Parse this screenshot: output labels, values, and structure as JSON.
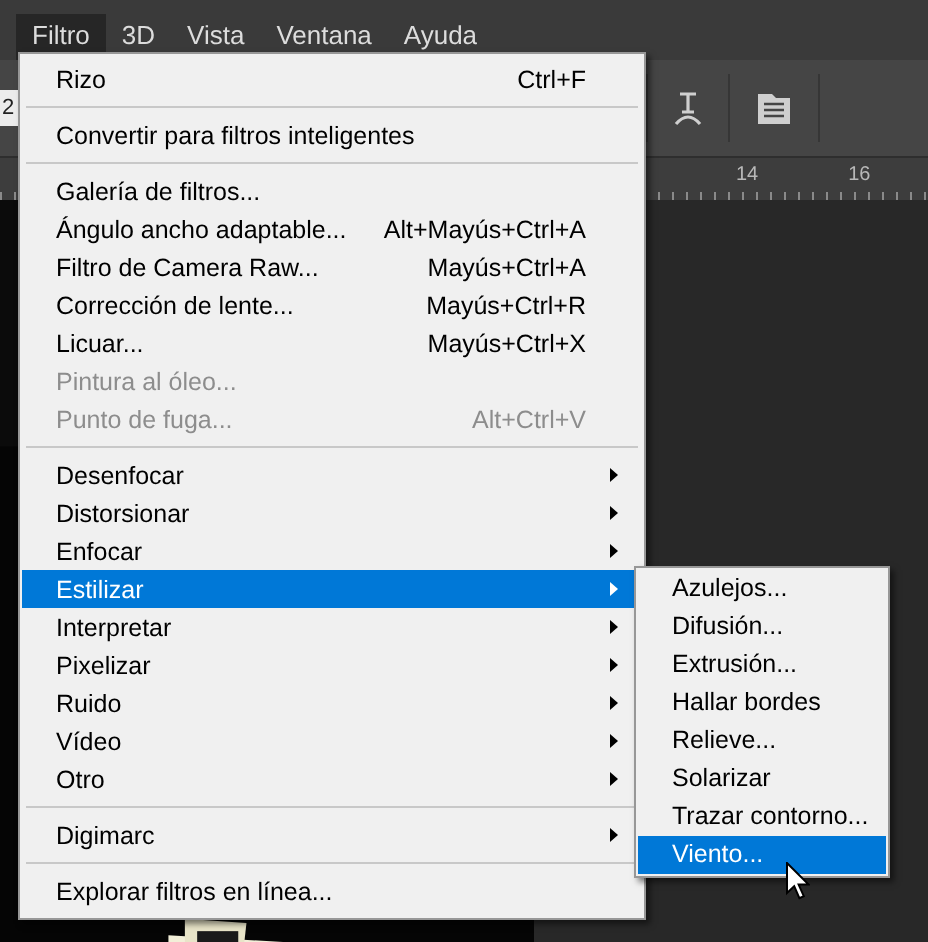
{
  "menubar": [
    {
      "label": "Filtro",
      "selected": true
    },
    {
      "label": "3D",
      "selected": false
    },
    {
      "label": "Vista",
      "selected": false
    },
    {
      "label": "Ventana",
      "selected": false
    },
    {
      "label": "Ayuda",
      "selected": false
    }
  ],
  "toolbar": {
    "field_value": "2"
  },
  "ruler": {
    "labels": [
      "14",
      "16"
    ]
  },
  "menu": [
    {
      "kind": "item",
      "label": "Rizo",
      "shortcut": "Ctrl+F",
      "disabled": false,
      "submenu": false,
      "selected": false
    },
    {
      "kind": "separator"
    },
    {
      "kind": "item",
      "label": "Convertir para filtros inteligentes",
      "disabled": false,
      "submenu": false,
      "selected": false
    },
    {
      "kind": "separator"
    },
    {
      "kind": "item",
      "label": "Galería de filtros...",
      "disabled": false,
      "submenu": false,
      "selected": false
    },
    {
      "kind": "item",
      "label": "Ángulo ancho adaptable...",
      "shortcut": "Alt+Mayús+Ctrl+A",
      "disabled": false,
      "submenu": false,
      "selected": false
    },
    {
      "kind": "item",
      "label": "Filtro de Camera Raw...",
      "shortcut": "Mayús+Ctrl+A",
      "disabled": false,
      "submenu": false,
      "selected": false
    },
    {
      "kind": "item",
      "label": "Corrección de lente...",
      "shortcut": "Mayús+Ctrl+R",
      "disabled": false,
      "submenu": false,
      "selected": false
    },
    {
      "kind": "item",
      "label": "Licuar...",
      "shortcut": "Mayús+Ctrl+X",
      "disabled": false,
      "submenu": false,
      "selected": false
    },
    {
      "kind": "item",
      "label": "Pintura al óleo...",
      "disabled": true,
      "submenu": false,
      "selected": false
    },
    {
      "kind": "item",
      "label": "Punto de fuga...",
      "shortcut": "Alt+Ctrl+V",
      "disabled": true,
      "submenu": false,
      "selected": false
    },
    {
      "kind": "separator"
    },
    {
      "kind": "item",
      "label": "Desenfocar",
      "disabled": false,
      "submenu": true,
      "selected": false
    },
    {
      "kind": "item",
      "label": "Distorsionar",
      "disabled": false,
      "submenu": true,
      "selected": false
    },
    {
      "kind": "item",
      "label": "Enfocar",
      "disabled": false,
      "submenu": true,
      "selected": false
    },
    {
      "kind": "item",
      "label": "Estilizar",
      "disabled": false,
      "submenu": true,
      "selected": true
    },
    {
      "kind": "item",
      "label": "Interpretar",
      "disabled": false,
      "submenu": true,
      "selected": false
    },
    {
      "kind": "item",
      "label": "Pixelizar",
      "disabled": false,
      "submenu": true,
      "selected": false
    },
    {
      "kind": "item",
      "label": "Ruido",
      "disabled": false,
      "submenu": true,
      "selected": false
    },
    {
      "kind": "item",
      "label": "Vídeo",
      "disabled": false,
      "submenu": true,
      "selected": false
    },
    {
      "kind": "item",
      "label": "Otro",
      "disabled": false,
      "submenu": true,
      "selected": false
    },
    {
      "kind": "separator"
    },
    {
      "kind": "item",
      "label": "Digimarc",
      "disabled": false,
      "submenu": true,
      "selected": false
    },
    {
      "kind": "separator"
    },
    {
      "kind": "item",
      "label": "Explorar filtros en línea...",
      "disabled": false,
      "submenu": false,
      "selected": false
    }
  ],
  "submenu": [
    {
      "label": "Azulejos...",
      "selected": false
    },
    {
      "label": "Difusión...",
      "selected": false
    },
    {
      "label": "Extrusión...",
      "selected": false
    },
    {
      "label": "Hallar bordes",
      "selected": false
    },
    {
      "label": "Relieve...",
      "selected": false
    },
    {
      "label": "Solarizar",
      "selected": false
    },
    {
      "label": "Trazar contorno...",
      "selected": false
    },
    {
      "label": "Viento...",
      "selected": true
    }
  ]
}
